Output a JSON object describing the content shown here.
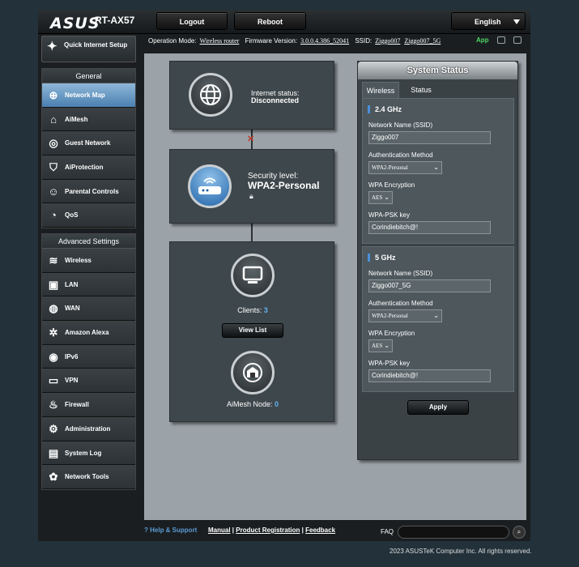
{
  "header": {
    "logo": "ASUS",
    "model": "RT-AX57",
    "logout": "Logout",
    "reboot": "Reboot",
    "language": "English"
  },
  "infobar": {
    "op_mode_label": "Operation Mode:",
    "op_mode": "Wireless router",
    "fw_label": "Firmware Version:",
    "fw": "3.0.0.4.386_52041",
    "ssid_label": "SSID:",
    "ssid1": "Ziggo007",
    "ssid2": "Ziggo007_5G",
    "app": "App"
  },
  "sidebar": {
    "qis": "Quick Internet Setup",
    "general_title": "General",
    "general": [
      {
        "label": "Network Map",
        "icon": "network-map-icon",
        "active": true
      },
      {
        "label": "AiMesh",
        "icon": "aimesh-icon"
      },
      {
        "label": "Guest Network",
        "icon": "guest-network-icon"
      },
      {
        "label": "AiProtection",
        "icon": "shield-icon"
      },
      {
        "label": "Parental Controls",
        "icon": "parental-icon"
      },
      {
        "label": "QoS",
        "icon": "qos-icon"
      }
    ],
    "advanced_title": "Advanced Settings",
    "advanced": [
      {
        "label": "Wireless",
        "icon": "wifi-icon"
      },
      {
        "label": "LAN",
        "icon": "lan-icon"
      },
      {
        "label": "WAN",
        "icon": "globe-icon"
      },
      {
        "label": "Amazon Alexa",
        "icon": "alexa-icon"
      },
      {
        "label": "IPv6",
        "icon": "ipv6-icon"
      },
      {
        "label": "VPN",
        "icon": "vpn-icon"
      },
      {
        "label": "Firewall",
        "icon": "firewall-icon"
      },
      {
        "label": "Administration",
        "icon": "admin-icon"
      },
      {
        "label": "System Log",
        "icon": "log-icon"
      },
      {
        "label": "Network Tools",
        "icon": "tools-icon"
      }
    ]
  },
  "map": {
    "internet_label": "Internet status:",
    "internet_value": "Disconnected",
    "security_label": "Security level:",
    "security_value": "WPA2-Personal",
    "clients_label": "Clients:",
    "clients_value": "3",
    "view_list": "View List",
    "aimesh_label": "AiMesh Node:",
    "aimesh_value": "0"
  },
  "status": {
    "title": "System Status",
    "tab_wireless": "Wireless",
    "tab_status": "Status",
    "bands": [
      {
        "title": "2.4 GHz",
        "ssid_label": "Network Name (SSID)",
        "ssid": "Ziggo007",
        "auth_label": "Authentication Method",
        "auth": "WPA2-Personal",
        "enc_label": "WPA Encryption",
        "enc": "AES",
        "psk_label": "WPA-PSK key",
        "psk": "Corindiebitch@!"
      },
      {
        "title": "5 GHz",
        "ssid_label": "Network Name (SSID)",
        "ssid": "Ziggo007_5G",
        "auth_label": "Authentication Method",
        "auth": "WPA2-Personal",
        "enc_label": "WPA Encryption",
        "enc": "AES",
        "psk_label": "WPA-PSK key",
        "psk": "Corindiebitch@!"
      }
    ],
    "apply": "Apply"
  },
  "footer": {
    "help": "Help & Support",
    "manual": "Manual",
    "registration": "Product Registration",
    "feedback": "Feedback",
    "sep": "|",
    "faq": "FAQ",
    "copyright": "2023 ASUSTeK Computer Inc. All rights reserved."
  }
}
